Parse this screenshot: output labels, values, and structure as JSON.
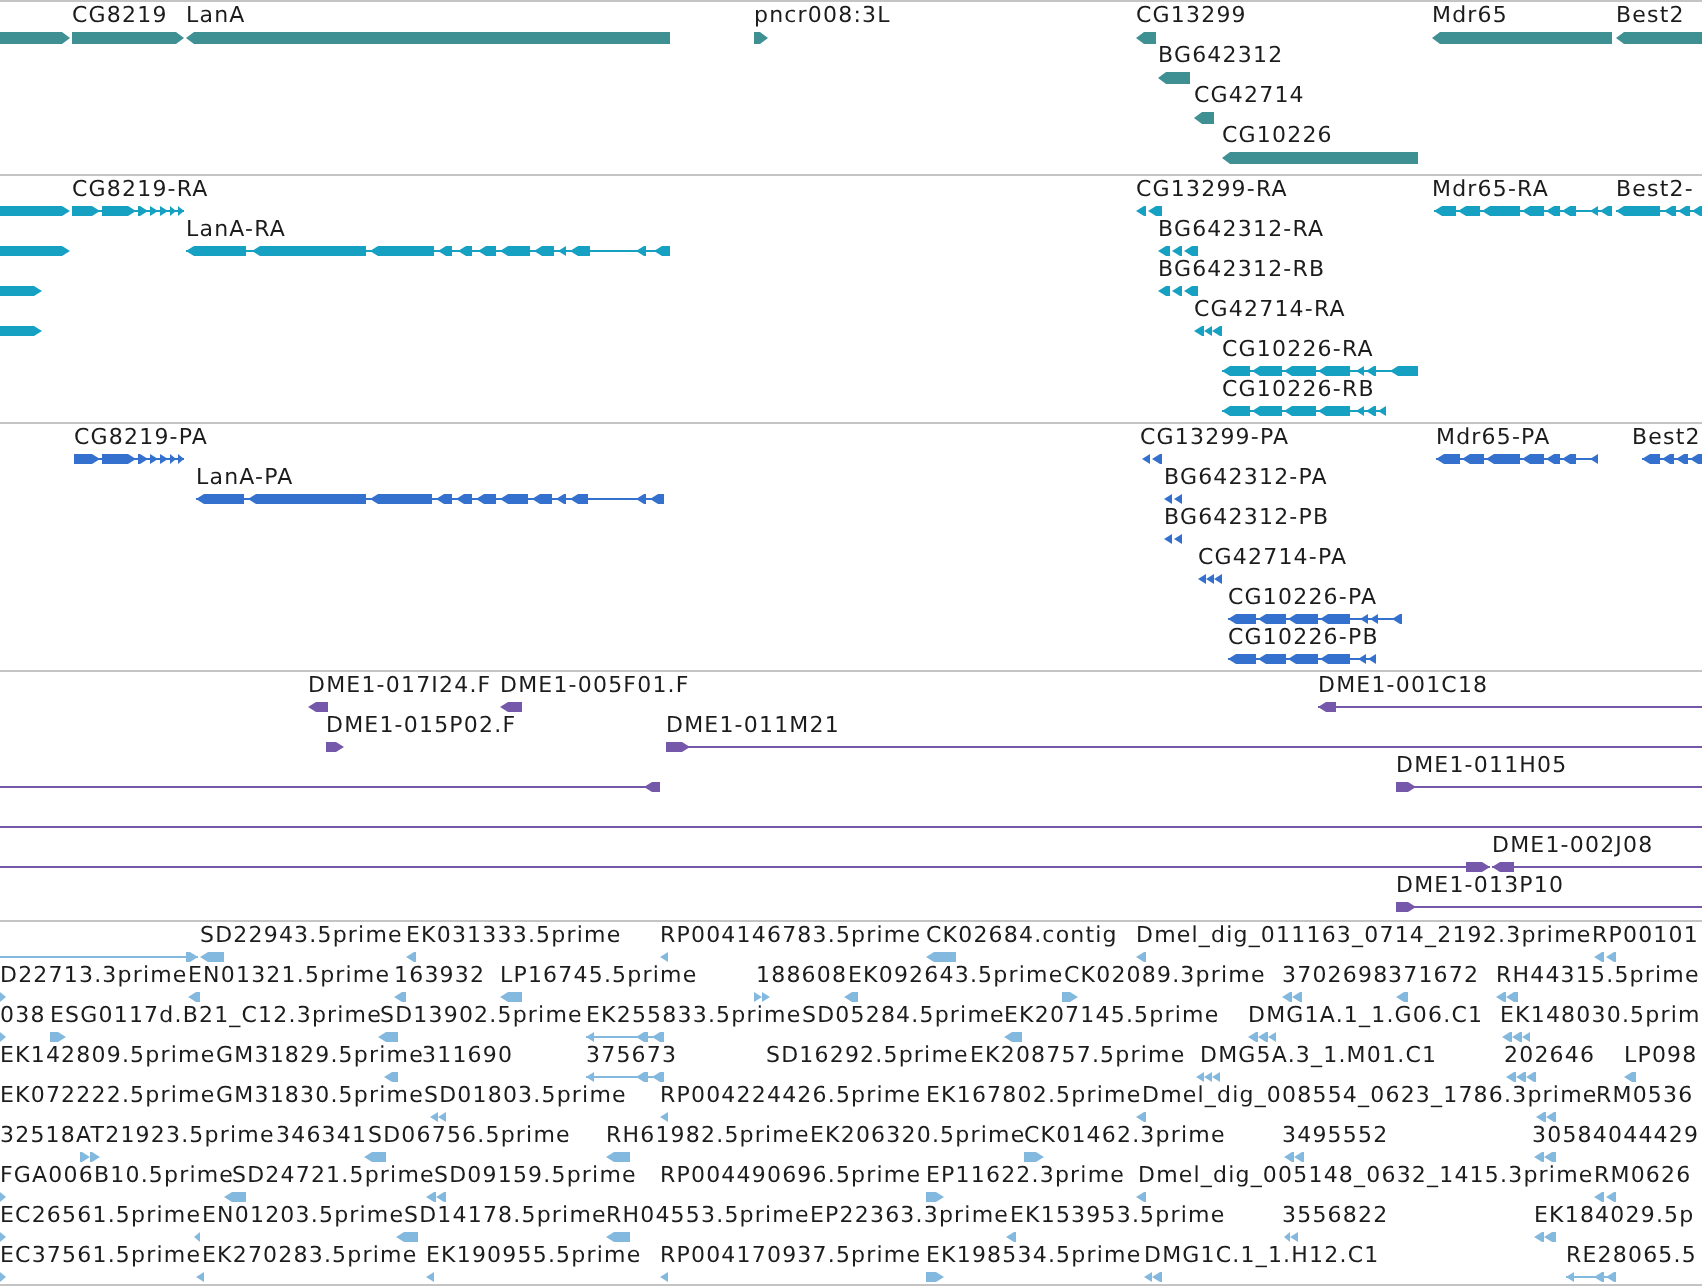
{
  "tracks": [
    {
      "kind": "gene",
      "features": [
        {
          "reverse": false
        },
        {
          "label": "CG8219",
          "reverse": false
        },
        {
          "label": "LanA",
          "reverse": true
        },
        {
          "label": "pncr008:3L",
          "reverse": false
        },
        {
          "label": "CG13299",
          "reverse": true
        },
        {
          "label": "Mdr65",
          "reverse": true
        },
        {
          "label": "Best2",
          "reverse": true
        },
        {
          "label": "BG642312",
          "reverse": true
        },
        {
          "label": "CG42714",
          "reverse": true
        },
        {
          "label": "CG10226",
          "reverse": true
        }
      ]
    },
    {
      "kind": "transcript",
      "features": [
        {
          "reverse": false
        },
        {
          "label": "CG8219-RA",
          "reverse": false
        },
        {
          "label": "CG13299-RA",
          "reverse": true
        },
        {
          "label": "Mdr65-RA",
          "reverse": true
        },
        {
          "label": "Best2-",
          "reverse": true
        },
        {
          "reverse": false
        },
        {
          "label": "LanA-RA",
          "reverse": true
        },
        {
          "label": "BG642312-RA",
          "reverse": true
        },
        {
          "reverse": false
        },
        {
          "label": "BG642312-RB",
          "reverse": true
        },
        {
          "reverse": false
        },
        {
          "label": "CG42714-RA",
          "reverse": true
        },
        {
          "label": "CG10226-RA",
          "reverse": true
        },
        {
          "label": "CG10226-RB",
          "reverse": true
        }
      ]
    },
    {
      "kind": "protein",
      "features": [
        {
          "label": "CG8219-PA",
          "reverse": false
        },
        {
          "label": "CG13299-PA",
          "reverse": true
        },
        {
          "label": "Mdr65-PA",
          "reverse": true
        },
        {
          "label": "Best2",
          "reverse": true
        },
        {
          "label": "LanA-PA",
          "reverse": true
        },
        {
          "label": "BG642312-PA",
          "reverse": true
        },
        {
          "label": "BG642312-PB",
          "reverse": true
        },
        {
          "label": "CG42714-PA",
          "reverse": true
        },
        {
          "label": "CG10226-PA",
          "reverse": true
        },
        {
          "label": "CG10226-PB",
          "reverse": true
        }
      ]
    },
    {
      "kind": "clone",
      "features": [
        {
          "kind": "arrow",
          "label": "DME1-017I24.F",
          "reverse": true
        },
        {
          "kind": "arrow",
          "label": "DME1-005F01.F",
          "reverse": true
        },
        {
          "kind": "arrow",
          "label": "DME1-001C18",
          "reverse": true
        },
        {
          "kind": "arrow",
          "label": "DME1-015P02.F",
          "reverse": false
        },
        {
          "kind": "arrow",
          "label": "DME1-011M21",
          "reverse": false
        },
        {
          "kind": "arrow",
          "reverse": true
        },
        {
          "kind": "arrow",
          "label": "DME1-011H05",
          "reverse": false
        },
        {
          "kind": "line"
        },
        {
          "kind": "arrow",
          "reverse": false
        },
        {
          "kind": "arrow",
          "label": "DME1-002J08",
          "reverse": true
        },
        {
          "kind": "arrow",
          "label": "DME1-013P10",
          "reverse": false
        }
      ]
    },
    {
      "kind": "est",
      "features": [
        {
          "reverse": false
        },
        {
          "label": "SD22943.5prime",
          "reverse": true
        },
        {
          "label": "EK031333.5prime",
          "reverse": true
        },
        {
          "label": "RP004146783.5prime",
          "reverse": true
        },
        {
          "label": "CK02684.contig",
          "reverse": true
        },
        {
          "label": "Dmel_dig_011163_0714_2192.3prime",
          "reverse": true
        },
        {
          "label": "RP00101",
          "reverse": true
        },
        {
          "label": "D22713.3prime",
          "reverse": false
        },
        {
          "label": "EN01321.5prime",
          "reverse": true
        },
        {
          "label": "163932",
          "reverse": true
        },
        {
          "label": "LP16745.5prime",
          "reverse": true
        },
        {
          "label": "188608",
          "reverse": false
        },
        {
          "label": "EK092643.5prime",
          "reverse": true
        },
        {
          "label": "CK02089.3prime",
          "reverse": false
        },
        {
          "label": "3702698",
          "reverse": true
        },
        {
          "label": "371672",
          "reverse": true
        },
        {
          "label": "RH44315.5prime",
          "reverse": true
        },
        {
          "label": "038",
          "reverse": false
        },
        {
          "label": "ESG0117d.B21_C12.3prime",
          "reverse": false
        },
        {
          "label": "SD13902.5prime",
          "reverse": true
        },
        {
          "label": "EK255833.5prime",
          "reverse": true
        },
        {
          "label": "SD05284.5prime"
        },
        {
          "label": "EK207145.5prime",
          "reverse": true
        },
        {
          "label": "DMG1A.1_1.G06.C1",
          "reverse": true
        },
        {
          "label": "EK148030.5prim",
          "reverse": true
        },
        {
          "label": "EK142809.5prime"
        },
        {
          "label": "GM31829.5prime"
        },
        {
          "label": "311690",
          "reverse": true
        },
        {
          "label": "375673",
          "reverse": true
        },
        {
          "label": "SD16292.5prime"
        },
        {
          "label": "EK208757.5prime"
        },
        {
          "label": "DMG5A.3_1.M01.C1",
          "reverse": true
        },
        {
          "label": "202646",
          "reverse": true
        },
        {
          "label": "LP098",
          "reverse": true
        },
        {
          "label": "EK072222.5prime"
        },
        {
          "label": "GM31830.5prime"
        },
        {
          "label": "SD01803.5prime",
          "reverse": true
        },
        {
          "label": "RP004224426.5prime",
          "reverse": true
        },
        {
          "label": "EK167802.5prime"
        },
        {
          "label": "Dmel_dig_008554_0623_1786.3prime",
          "reverse": true
        },
        {
          "label": "RM0536",
          "reverse": true
        },
        {
          "label": "32518"
        },
        {
          "label": "AT21923.5prime",
          "reverse": false
        },
        {
          "label": "346341"
        },
        {
          "label": "SD06756.5prime",
          "reverse": true
        },
        {
          "label": "RH61982.5prime",
          "reverse": true
        },
        {
          "label": "EK206320.5prime"
        },
        {
          "label": "CK01462.3prime",
          "reverse": false
        },
        {
          "label": "3495552",
          "reverse": true
        },
        {
          "label": "30584044429",
          "reverse": true
        },
        {
          "label": "FGA006B10.5prime",
          "reverse": false
        },
        {
          "label": "SD24721.5prime",
          "reverse": true
        },
        {
          "label": "SD09159.5prime",
          "reverse": true
        },
        {
          "label": "RP004490696.5prime"
        },
        {
          "label": "EP11622.3prime",
          "reverse": false
        },
        {
          "label": "Dmel_dig_005148_0632_1415.3prime",
          "reverse": true
        },
        {
          "label": "RM0626",
          "reverse": true
        },
        {
          "label": "EC26561.5prime",
          "reverse": false
        },
        {
          "label": "EN01203.5prime",
          "reverse": true
        },
        {
          "label": "SD14178.5prime",
          "reverse": true
        },
        {
          "label": "RH04553.5prime",
          "reverse": true
        },
        {
          "label": "EP22363.3prime"
        },
        {
          "label": "EK153953.5prime",
          "reverse": true
        },
        {
          "label": "3556822",
          "reverse": true
        },
        {
          "label": "EK184029.5p",
          "reverse": true
        },
        {
          "label": "EC37561.5prime",
          "reverse": false
        },
        {
          "label": "EK270283.5prime",
          "reverse": true
        },
        {
          "label": "EK190955.5prime",
          "reverse": true
        },
        {
          "label": "RP004170937.5prime",
          "reverse": true
        },
        {
          "label": "EK198534.5prime",
          "reverse": false
        },
        {
          "label": "DMG1C.1_1.H12.C1",
          "reverse": true
        },
        {
          "label": "RE28065.5",
          "reverse": true
        }
      ]
    }
  ]
}
